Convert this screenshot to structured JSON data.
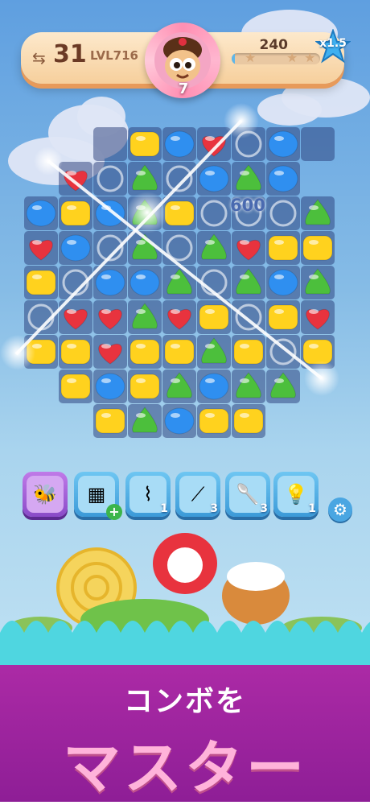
{
  "hud": {
    "moves_left": "31",
    "level_label": "LVL716",
    "avatar_count": "7",
    "score": "240",
    "multiplier": "x1.5",
    "progress": 0.04
  },
  "board": {
    "score_popup": "600",
    "rows": [
      [
        null,
        null,
        "cell",
        "Y",
        "B",
        "R",
        "W",
        "B",
        "cell",
        null
      ],
      [
        null,
        "R",
        "W",
        "G",
        "W",
        "B",
        "G",
        "B",
        null,
        null
      ],
      [
        "B",
        "Y",
        "B",
        "G",
        "Y",
        "W",
        "W",
        "W",
        "G",
        null
      ],
      [
        "R",
        "B",
        "W",
        "G",
        "W",
        "G",
        "R",
        "Y",
        "Y",
        null
      ],
      [
        "Y",
        "W",
        "B",
        "B",
        "G",
        "W",
        "G",
        "B",
        "G",
        null
      ],
      [
        "W",
        "R",
        "R",
        "G",
        "R",
        "Y",
        "W",
        "Y",
        "R",
        null
      ],
      [
        "Y",
        "Y",
        "R",
        "Y",
        "Y",
        "G",
        "Y",
        "W",
        "Y",
        null
      ],
      [
        null,
        "Y",
        "B",
        "Y",
        "G",
        "B",
        "G",
        "G",
        null,
        null
      ],
      [
        null,
        null,
        "Y",
        "G",
        "B",
        "Y",
        "Y",
        null,
        null,
        null
      ]
    ]
  },
  "boosters": [
    {
      "name": "bee-box",
      "icon": "bee-box-icon",
      "count": "",
      "selected": true
    },
    {
      "name": "chocolate-bar",
      "icon": "chocolate-bar-icon",
      "count": "+",
      "selected": false
    },
    {
      "name": "piping-bag",
      "icon": "piping-bag-icon",
      "count": "1",
      "selected": false
    },
    {
      "name": "candy-stick",
      "icon": "candy-stick-icon",
      "count": "3",
      "selected": false
    },
    {
      "name": "wooden-spoon",
      "icon": "wooden-spoon-icon",
      "count": "3",
      "selected": false
    },
    {
      "name": "lightbulb",
      "icon": "lightbulb-icon",
      "count": "1",
      "selected": false
    }
  ],
  "caption": {
    "line1": "コンボを",
    "line2": "マスター"
  },
  "colors": {
    "footer": "#a026a0",
    "caption_pink": "#ffb3da",
    "wave": "#4fd6e0"
  }
}
